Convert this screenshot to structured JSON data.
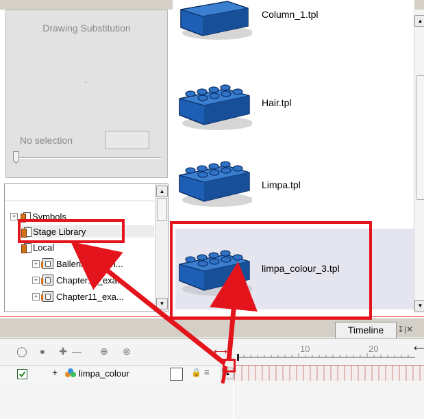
{
  "drawing_substitution": {
    "title": "Drawing Substitution",
    "no_selection": "No selection"
  },
  "library_tree": {
    "items": [
      {
        "label": "Symbols",
        "icon": "folder-icon"
      },
      {
        "label": "Stage Library",
        "icon": "folder-icon"
      },
      {
        "label": "Local",
        "icon": "folder-icon"
      },
      {
        "label": "Ballerina_open...",
        "icon": "library-icon"
      },
      {
        "label": "Chapter10_exa...",
        "icon": "library-icon"
      },
      {
        "label": "Chapter11_exa...",
        "icon": "library-icon"
      }
    ]
  },
  "templates": {
    "items": [
      {
        "label": "Column_1.tpl"
      },
      {
        "label": "Hair.tpl"
      },
      {
        "label": "Limpa.tpl"
      },
      {
        "label": "limpa_colour_3.tpl"
      }
    ]
  },
  "timeline": {
    "tab_label": "Timeline",
    "ruler_ticks": [
      "10",
      "20"
    ],
    "layer": {
      "name": "limpa_colour",
      "checked": true
    }
  },
  "colors": {
    "brick_blue": "#1d5fb4",
    "annotation_red": "#e4141c",
    "panel_gray": "#e2e2e2"
  }
}
